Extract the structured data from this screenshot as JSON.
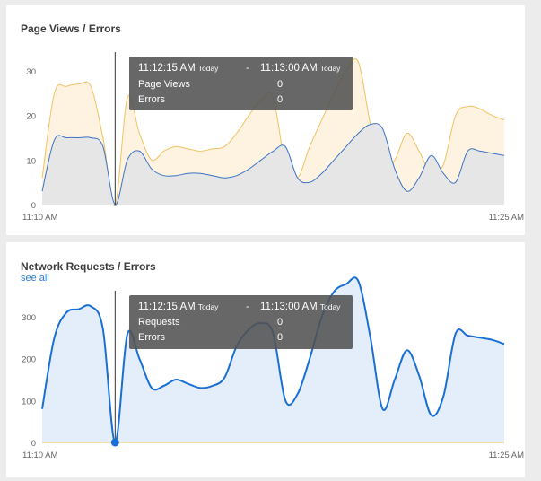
{
  "colors": {
    "page_views_stroke": "#f0c263",
    "page_views_fill": "#fdf3e0",
    "errors_stroke": "#3b73c6",
    "errors_fill": "#e6e6e6",
    "requests_stroke": "#1a6fd4",
    "requests_fill": "#e3eefa",
    "req_errors_stroke": "#e8c34c",
    "tooltip_bg": "#525252"
  },
  "panels": [
    {
      "title": "Page Views / Errors",
      "tooltip": {
        "start_time": "11:12:15 AM",
        "start_day": "Today",
        "separator": "-",
        "end_time": "11:13:00 AM",
        "end_day": "Today",
        "rows": [
          {
            "label": "Page Views",
            "value": "0"
          },
          {
            "label": "Errors",
            "value": "0"
          }
        ]
      }
    },
    {
      "title": "Network Requests / Errors",
      "link": "see all",
      "tooltip": {
        "start_time": "11:12:15 AM",
        "start_day": "Today",
        "separator": "-",
        "end_time": "11:13:00 AM",
        "end_day": "Today",
        "rows": [
          {
            "label": "Requests",
            "value": "0"
          },
          {
            "label": "Errors",
            "value": "0"
          }
        ]
      }
    }
  ],
  "chart_data": [
    {
      "type": "area",
      "x_start_label": "11:10 AM",
      "x_end_label": "11:25 AM",
      "ylim": [
        0,
        32
      ],
      "y_ticks": [
        0,
        10,
        20,
        30
      ],
      "grid": false,
      "x_steps": 39,
      "cursor_index": 6,
      "series": [
        {
          "name": "Page Views",
          "values": [
            6,
            25,
            26.5,
            27,
            26.5,
            15,
            0,
            24,
            16,
            10,
            12,
            13,
            12.5,
            12,
            12.5,
            13,
            16,
            20,
            23.5,
            24,
            9,
            6,
            13,
            19,
            25,
            30,
            32,
            18,
            8,
            10,
            16,
            12,
            7,
            9,
            20,
            22,
            21.5,
            20,
            19
          ]
        },
        {
          "name": "Errors",
          "values": [
            3,
            14.5,
            15,
            15,
            15,
            13,
            0,
            10,
            12,
            8,
            6.5,
            6.5,
            7,
            7,
            6.5,
            6,
            6.5,
            8,
            10,
            12,
            13,
            6,
            5,
            7,
            10,
            13,
            16,
            18,
            17,
            8,
            3,
            6,
            11,
            7,
            5,
            12,
            12,
            11.5,
            11
          ]
        }
      ]
    },
    {
      "type": "area",
      "x_start_label": "11:10 AM",
      "x_end_label": "11:25 AM",
      "ylim": [
        0,
        390
      ],
      "y_ticks": [
        0,
        100,
        200,
        300
      ],
      "grid": false,
      "x_steps": 39,
      "cursor_index": 6,
      "series": [
        {
          "name": "Requests",
          "values": [
            80,
            250,
            310,
            318,
            325,
            270,
            0,
            258,
            200,
            130,
            135,
            150,
            140,
            130,
            135,
            155,
            230,
            270,
            285,
            260,
            100,
            115,
            200,
            300,
            360,
            378,
            385,
            250,
            80,
            150,
            220,
            160,
            65,
            110,
            260,
            255,
            250,
            245,
            235
          ]
        },
        {
          "name": "Errors",
          "values": [
            0,
            0,
            0,
            0,
            0,
            0,
            0,
            0,
            0,
            0,
            0,
            0,
            0,
            0,
            0,
            0,
            0,
            0,
            0,
            0,
            0,
            0,
            0,
            0,
            0,
            0,
            0,
            0,
            0,
            0,
            0,
            0,
            0,
            0,
            0,
            0,
            0,
            0,
            0
          ]
        }
      ]
    }
  ]
}
